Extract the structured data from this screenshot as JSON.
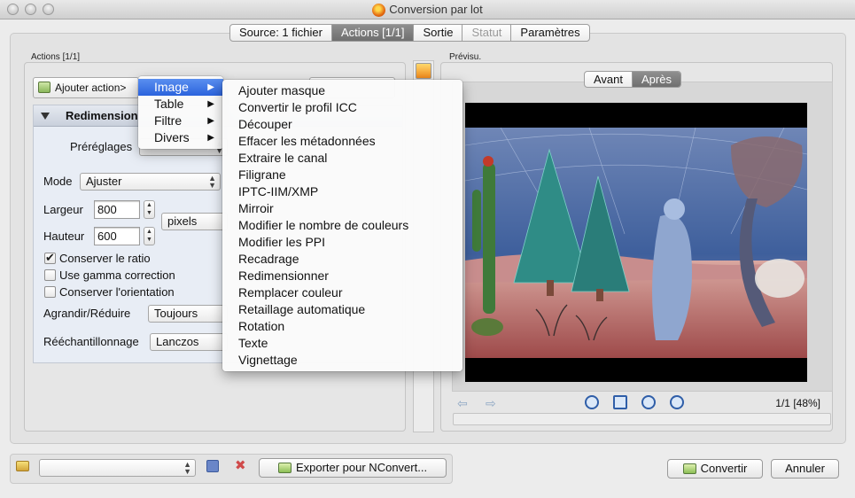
{
  "window": {
    "title": "Conversion par lot"
  },
  "tabs": [
    {
      "label": "Source: 1 fichier",
      "state": "normal"
    },
    {
      "label": "Actions [1/1]",
      "state": "active"
    },
    {
      "label": "Sortie",
      "state": "normal"
    },
    {
      "label": "Statut",
      "state": "disabled"
    },
    {
      "label": "Paramètres",
      "state": "normal"
    }
  ],
  "actions": {
    "group_label": "Actions [1/1]",
    "add_button": "Ajouter action>",
    "section_title": "Redimension",
    "presets_label": "Préréglages",
    "mode_label": "Mode",
    "mode_value": "Ajuster",
    "width_label": "Largeur",
    "width_value": "800",
    "height_label": "Hauteur",
    "height_value": "600",
    "unit_value": "pixels",
    "keep_ratio": {
      "label": "Conserver le ratio",
      "checked": true
    },
    "gamma": {
      "label": "Use gamma correction",
      "checked": false
    },
    "orientation": {
      "label": "Conserver l'orientation",
      "checked": false
    },
    "enlarge_label": "Agrandir/Réduire",
    "enlarge_value": "Toujours",
    "resample_label": "Rééchantillonnage",
    "resample_value": "Lanczos"
  },
  "menu_main": [
    {
      "label": "Image",
      "highlighted": true
    },
    {
      "label": "Table",
      "highlighted": false
    },
    {
      "label": "Filtre",
      "highlighted": false
    },
    {
      "label": "Divers",
      "highlighted": false
    }
  ],
  "menu_image": [
    "Ajouter masque",
    "Convertir le profil ICC",
    "Découper",
    "Effacer les métadonnées",
    "Extraire le canal",
    "Filigrane",
    "IPTC-IIM/XMP",
    "Mirroir",
    "Modifier le nombre de couleurs",
    "Modifier les PPI",
    "Recadrage",
    "Redimensionner",
    "Remplacer couleur",
    "Retaillage automatique",
    "Rotation",
    "Texte",
    "Vignettage"
  ],
  "preview": {
    "group_label": "Prévisu.",
    "tab_before": "Avant",
    "tab_after": "Après",
    "page_zoom": "1/1 [48%]"
  },
  "bottom": {
    "export_button": "Exporter pour NConvert...",
    "convert_button": "Convertir",
    "cancel_button": "Annuler"
  },
  "colors": {
    "accent": "#2b63dd",
    "active_tab": "#7f7f7f"
  }
}
